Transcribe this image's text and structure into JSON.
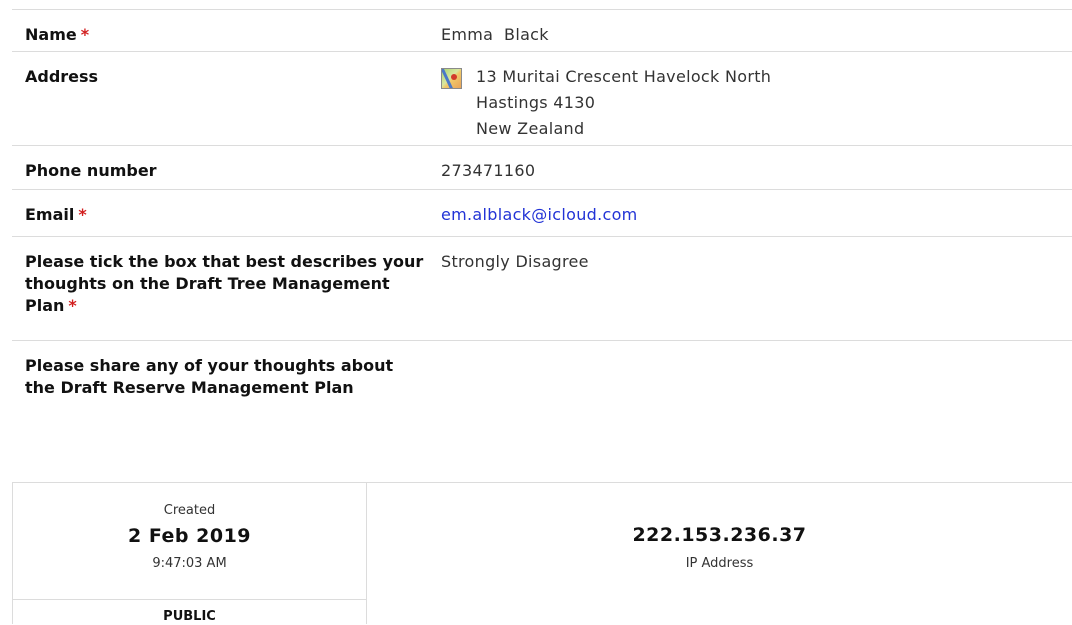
{
  "fields": {
    "name": {
      "label": "Name",
      "required_mark": "*",
      "value": "Emma  Black"
    },
    "address": {
      "label": "Address",
      "icon": "map-icon",
      "lines": [
        "13 Muritai Crescent Havelock North",
        "Hastings 4130",
        "New Zealand"
      ]
    },
    "phone": {
      "label": "Phone number",
      "value": "273471160"
    },
    "email": {
      "label": "Email",
      "required_mark": "*",
      "value": "em.alblack@icloud.com",
      "link_color": "#2233d6"
    },
    "tree_plan": {
      "label": "Please tick the box that best describes your thoughts on the Draft Tree Management Plan",
      "required_mark": "*",
      "value": "Strongly Disagree"
    },
    "reserve_plan": {
      "label": "Please share any of your thoughts about the Draft Reserve Management Plan",
      "value": ""
    }
  },
  "footer": {
    "created_label": "Created",
    "created_date": "2 Feb 2019",
    "created_time": "9:47:03 AM",
    "visibility": "PUBLIC",
    "ip": "222.153.236.37",
    "ip_label": "IP Address"
  },
  "colors": {
    "required": "#d21f1f",
    "divider": "#dcdcdc"
  }
}
